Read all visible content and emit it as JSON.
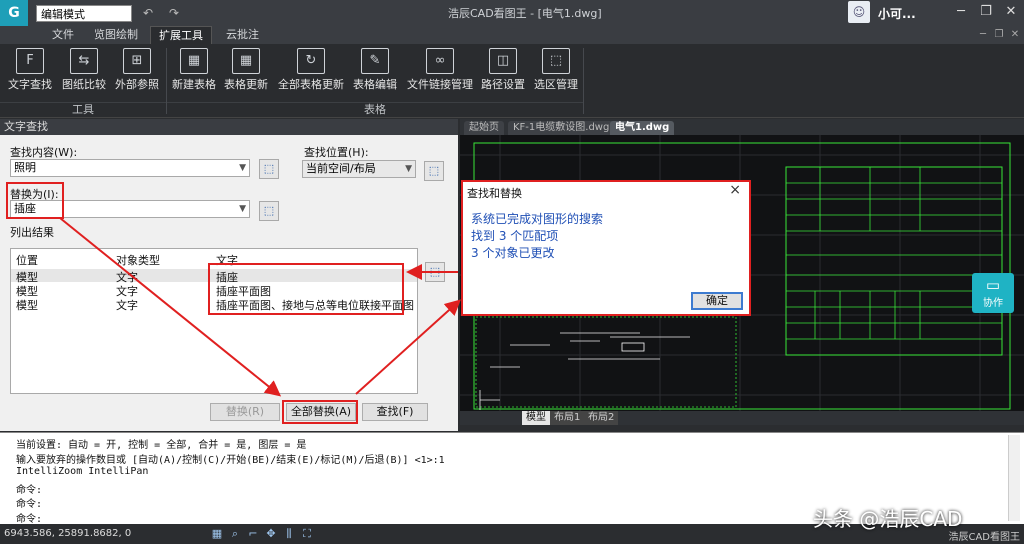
{
  "titlebar": {
    "mode": "编辑模式",
    "title": "浩辰CAD看图王 - [电气1.dwg]",
    "user": "小可...",
    "logo": "G"
  },
  "menu": {
    "tabs": [
      {
        "label": "文件"
      },
      {
        "label": "览图绘制"
      },
      {
        "label": "扩展工具",
        "active": true
      },
      {
        "label": "云批注"
      }
    ]
  },
  "ribbon": {
    "buttons": [
      {
        "label": "文字查找",
        "icon": "F"
      },
      {
        "label": "图纸比较",
        "icon": "⇆"
      },
      {
        "label": "外部参照",
        "icon": "⊞"
      },
      {
        "label": "新建表格",
        "icon": "▦"
      },
      {
        "label": "表格更新",
        "icon": "▦"
      },
      {
        "label": "全部表格更新",
        "icon": "↻"
      },
      {
        "label": "表格编辑",
        "icon": "✎"
      },
      {
        "label": "文件链接管理",
        "icon": "∞"
      },
      {
        "label": "路径设置",
        "icon": "◫"
      },
      {
        "label": "选区管理",
        "icon": "⬚"
      }
    ],
    "groups": {
      "tools": "工具",
      "tables": "表格"
    }
  },
  "find_panel": {
    "title": "文字查找",
    "find_label": "查找内容(W):",
    "find_value": "照明",
    "location_label": "查找位置(H):",
    "location_value": "当前空间/布局",
    "replace_label": "替换为(I):",
    "replace_value": "插座",
    "results_label": "列出结果",
    "columns": [
      "位置",
      "对象类型",
      "文字"
    ],
    "rows": [
      {
        "pos": "模型",
        "type": "文字",
        "text": "插座"
      },
      {
        "pos": "模型",
        "type": "文字",
        "text": "插座平面图"
      },
      {
        "pos": "模型",
        "type": "文字",
        "text": "插座平面图、接地与总等电位联接平面图"
      }
    ],
    "btn_replace": "替换(R)",
    "btn_replace_all": "全部替换(A)",
    "btn_find": "查找(F)"
  },
  "doc_tabs": [
    {
      "label": "起始页"
    },
    {
      "label": "KF-1电缆敷设图.dwg"
    },
    {
      "label": "电气1.dwg",
      "active": true
    }
  ],
  "layout_tabs": [
    {
      "label": "模型",
      "active": true
    },
    {
      "label": "布局1"
    },
    {
      "label": "布局2"
    }
  ],
  "dialog": {
    "title": "查找和替换",
    "lines": [
      "系统已完成对图形的搜索",
      "找到 3 个匹配项",
      "3 个对象已更改"
    ],
    "ok": "确定"
  },
  "collab": {
    "label": "协作"
  },
  "command": {
    "lines": [
      "当前设置: 自动 = 开, 控制 = 全部, 合并 = 是, 图层 = 是",
      "输入要放弃的操作数目或 [自动(A)/控制(C)/开始(BE)/结束(E)/标记(M)/后退(B)] <1>:1",
      "IntelliZoom IntelliPan",
      "命令:",
      "命令:",
      "命令:"
    ]
  },
  "status": {
    "coords": "6943.586, 25891.8682, 0",
    "app": "浩辰CAD看图王"
  },
  "watermark": "头条 @浩辰CAD",
  "colors": {
    "accent": "#1fb3c4",
    "highlight": "#e02020",
    "cad_green": "#39e639"
  }
}
